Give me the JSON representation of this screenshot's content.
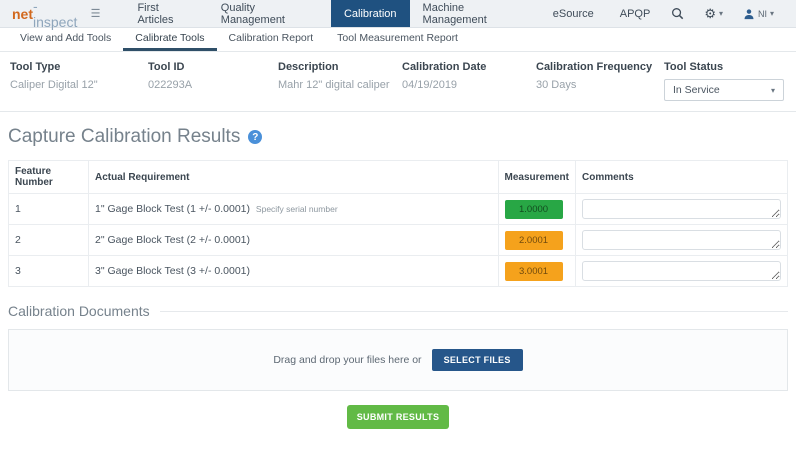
{
  "brand": {
    "logo_bold": "net",
    "logo_light": "-inspect"
  },
  "topnav": {
    "items": [
      {
        "label": "First Articles",
        "active": false
      },
      {
        "label": "Quality Management",
        "active": false
      },
      {
        "label": "Calibration",
        "active": true
      },
      {
        "label": "Machine Management",
        "active": false
      },
      {
        "label": "eSource",
        "active": false
      },
      {
        "label": "APQP",
        "active": false
      }
    ],
    "user_initials": "NI"
  },
  "tabs": [
    {
      "label": "View and Add Tools",
      "active": false
    },
    {
      "label": "Calibrate Tools",
      "active": true
    },
    {
      "label": "Calibration Report",
      "active": false
    },
    {
      "label": "Tool Measurement Report",
      "active": false
    }
  ],
  "tool_info": {
    "fields": [
      {
        "label": "Tool Type",
        "value": "Caliper Digital 12\""
      },
      {
        "label": "Tool ID",
        "value": "022293A"
      },
      {
        "label": "Description",
        "value": "Mahr 12\" digital caliper"
      },
      {
        "label": "Calibration Date",
        "value": "04/19/2019"
      },
      {
        "label": "Calibration Frequency",
        "value": "30 Days"
      }
    ],
    "status_label": "Tool Status",
    "status_value": "In Service"
  },
  "capture_section": {
    "title": "Capture Calibration Results",
    "help_glyph": "?"
  },
  "table": {
    "headers": [
      "Feature Number",
      "Actual Requirement",
      "Measurement",
      "Comments"
    ],
    "rows": [
      {
        "feature": "1",
        "requirement": "1\" Gage Block Test (1 +/- 0.0001)",
        "note": "Specify serial number",
        "measurement": "1.0000",
        "status_color": "#28a745",
        "comment": ""
      },
      {
        "feature": "2",
        "requirement": "2\" Gage Block Test (2 +/- 0.0001)",
        "note": "",
        "measurement": "2.0001",
        "status_color": "#f5a21c",
        "comment": ""
      },
      {
        "feature": "3",
        "requirement": "3\" Gage Block Test (3 +/- 0.0001)",
        "note": "",
        "measurement": "3.0001",
        "status_color": "#f5a21c",
        "comment": ""
      }
    ]
  },
  "documents_section": {
    "title": "Calibration Documents",
    "dropzone_text": "Drag and drop your files here or",
    "select_button": "SELECT FILES"
  },
  "submit_button": "SUBMIT RESULTS",
  "colors": {
    "nav_active_bg": "#1f5180",
    "pass_green": "#28a745",
    "fail_orange": "#f5a21c",
    "submit_green": "#62ba46",
    "select_files_blue": "#26568a",
    "help_blue": "#4a90d9"
  }
}
